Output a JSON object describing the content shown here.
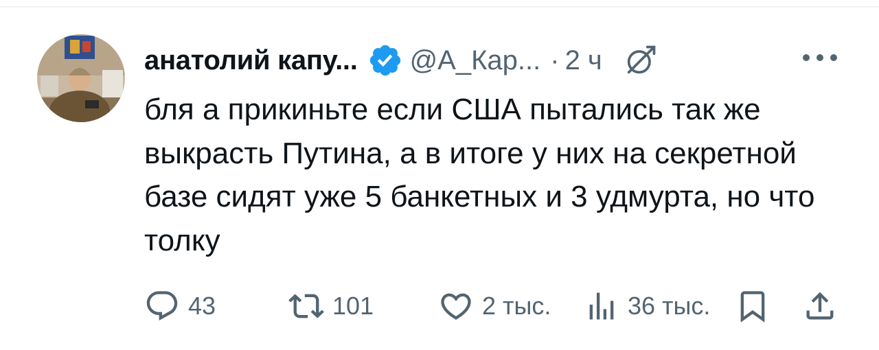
{
  "author": {
    "display_name": "анатолий капу...",
    "handle": "@А_Кар...",
    "separator": "·",
    "time": "2 ч"
  },
  "tweet": {
    "text": "бля а прикиньте если США пытались так же выкрасть Путина, а в итоге у них на секретной базе сидят уже 5 банкетных и 3 удмурта, но что толку"
  },
  "actions": {
    "replies": "43",
    "reposts": "101",
    "likes": "2 тыс.",
    "views": "36 тыс."
  },
  "icons": [
    "verified-badge-icon",
    "grok-icon",
    "more-icon",
    "reply-icon",
    "repost-icon",
    "like-icon",
    "views-icon",
    "bookmark-icon",
    "share-icon"
  ],
  "colors": {
    "verified": "#1d9bf0",
    "text": "#0f1419",
    "muted": "#536471"
  }
}
